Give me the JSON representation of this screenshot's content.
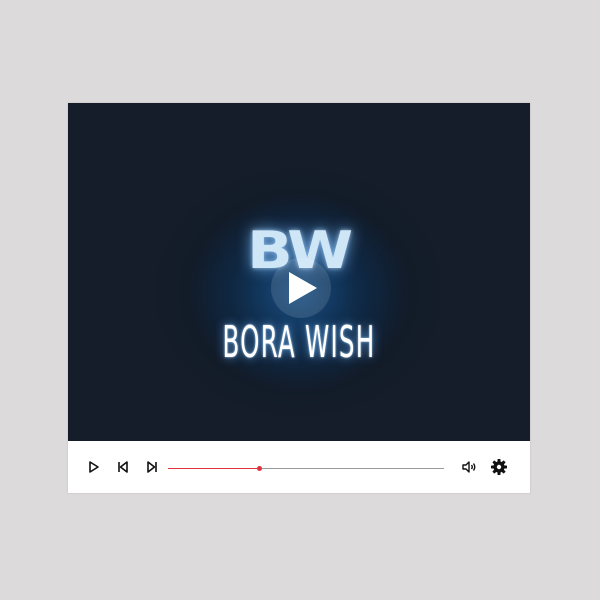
{
  "video": {
    "logo_monogram": "BW",
    "logo_name": "BORA WISH"
  },
  "controls": {
    "progress": 0.33,
    "icons": {
      "play": "play-icon",
      "previous": "skip-previous-icon",
      "next": "skip-next-icon",
      "volume": "volume-icon",
      "settings": "gear-icon",
      "big_play": "play-overlay-icon"
    },
    "colors": {
      "progress_fill": "#e0323a",
      "progress_track": "#9a9a9a",
      "icon": "#111111"
    }
  }
}
